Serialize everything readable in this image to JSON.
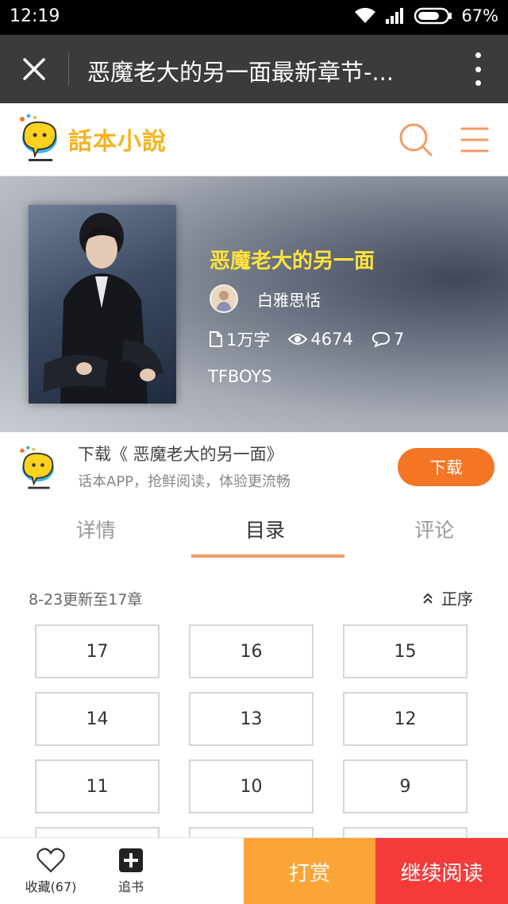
{
  "status_bar": {
    "time": "12:19",
    "battery": "67%"
  },
  "browser": {
    "title": "恶魔老大的另一面最新章节-..."
  },
  "site": {
    "logo_text": "話本小說"
  },
  "book": {
    "title": "恶魔老大的另一面",
    "author": "白雅思恬",
    "word_count": "1万字",
    "views": "4674",
    "comments": "7",
    "tag": "TFBOYS"
  },
  "download_banner": {
    "title": "下载《 恶魔老大的另一面》",
    "subtitle": "话本APP，抢鲜阅读，体验更流畅",
    "button": "下载"
  },
  "tabs": [
    {
      "label": "详情",
      "active": false
    },
    {
      "label": "目录",
      "active": true
    },
    {
      "label": "评论",
      "active": false
    }
  ],
  "toc": {
    "update_info": "8-23更新至17章",
    "order_label": "正序"
  },
  "chapters": [
    "17",
    "16",
    "15",
    "14",
    "13",
    "12",
    "11",
    "10",
    "9"
  ],
  "bottom_bar": {
    "favorite_label": "收藏(67)",
    "follow_label": "追书",
    "tip_label": "打赏",
    "read_label": "继续阅读"
  },
  "colors": {
    "accent_orange": "#f47524",
    "title_yellow": "#ffe33b",
    "tip_orange": "#fca437",
    "read_red": "#f43b3a"
  }
}
